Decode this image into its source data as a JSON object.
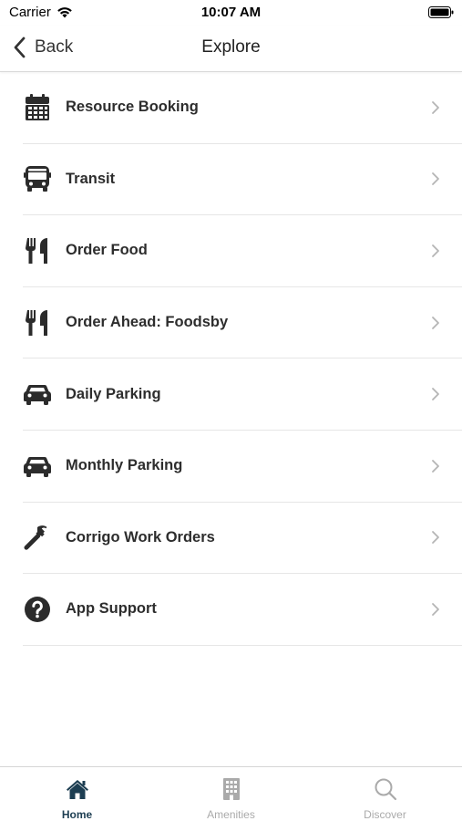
{
  "status_bar": {
    "carrier": "Carrier",
    "time": "10:07 AM"
  },
  "nav": {
    "back_label": "Back",
    "title": "Explore"
  },
  "items": [
    {
      "label": "Resource Booking",
      "icon": "calendar-icon"
    },
    {
      "label": "Transit",
      "icon": "bus-icon"
    },
    {
      "label": "Order Food",
      "icon": "utensils-icon"
    },
    {
      "label": "Order Ahead: Foodsby",
      "icon": "utensils-icon"
    },
    {
      "label": "Daily Parking",
      "icon": "car-icon"
    },
    {
      "label": "Monthly Parking",
      "icon": "car-icon"
    },
    {
      "label": "Corrigo Work Orders",
      "icon": "hammer-icon"
    },
    {
      "label": "App Support",
      "icon": "question-circle-icon"
    }
  ],
  "tabs": [
    {
      "label": "Home",
      "icon": "home-icon",
      "active": true
    },
    {
      "label": "Amenities",
      "icon": "building-icon",
      "active": false
    },
    {
      "label": "Discover",
      "icon": "search-icon",
      "active": false
    }
  ],
  "colors": {
    "icon": "#2b2b2b",
    "chevron": "#b5b5b5",
    "active_tab": "#1d3e52",
    "inactive_tab": "#aaaaaa",
    "divider": "#e6e6e6"
  }
}
